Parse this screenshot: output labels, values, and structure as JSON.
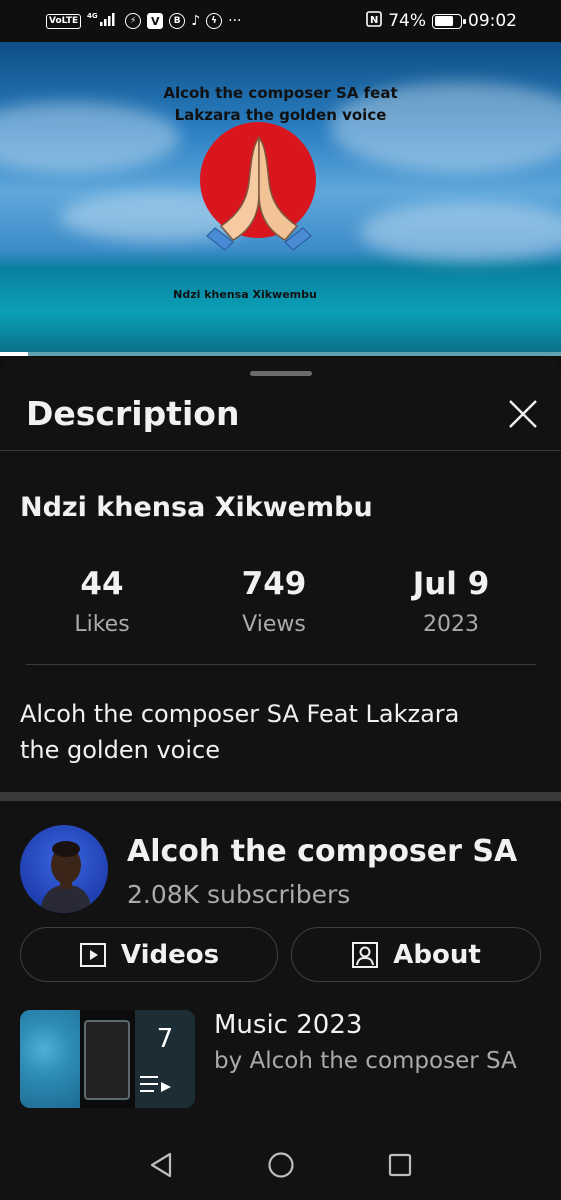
{
  "status_bar": {
    "network_tag": "VoLTE",
    "network_type": "4G",
    "battery_percent": "74%",
    "battery_level": 0.74,
    "time": "09:02",
    "more": "···"
  },
  "video": {
    "overlay_title_line1": "Alcoh the composer SA feat",
    "overlay_title_line2": "Lakzara the golden voice",
    "overlay_subtitle": "Ndzi khensa Xikwembu",
    "progress": 0.05
  },
  "description": {
    "heading": "Description",
    "video_title": "Ndzi khensa Xikwembu",
    "stats": [
      {
        "value": "44",
        "label": "Likes"
      },
      {
        "value": "749",
        "label": "Views"
      },
      {
        "value": "Jul 9",
        "label": "2023"
      }
    ],
    "text_line1": "Alcoh the composer SA Feat Lakzara",
    "text_line2": "the golden voice"
  },
  "channel": {
    "name": "Alcoh the composer SA",
    "subscribers": "2.08K subscribers",
    "videos_label": "Videos",
    "about_label": "About"
  },
  "playlist": {
    "count": "7",
    "title": "Music 2023",
    "byline": "by Alcoh the composer SA"
  },
  "colors": {
    "background": "#0f0f0f",
    "sheet": "#121212",
    "text_primary": "#f1f1f1",
    "text_secondary": "#aaaaaa",
    "divider": "#3a3a3a"
  }
}
